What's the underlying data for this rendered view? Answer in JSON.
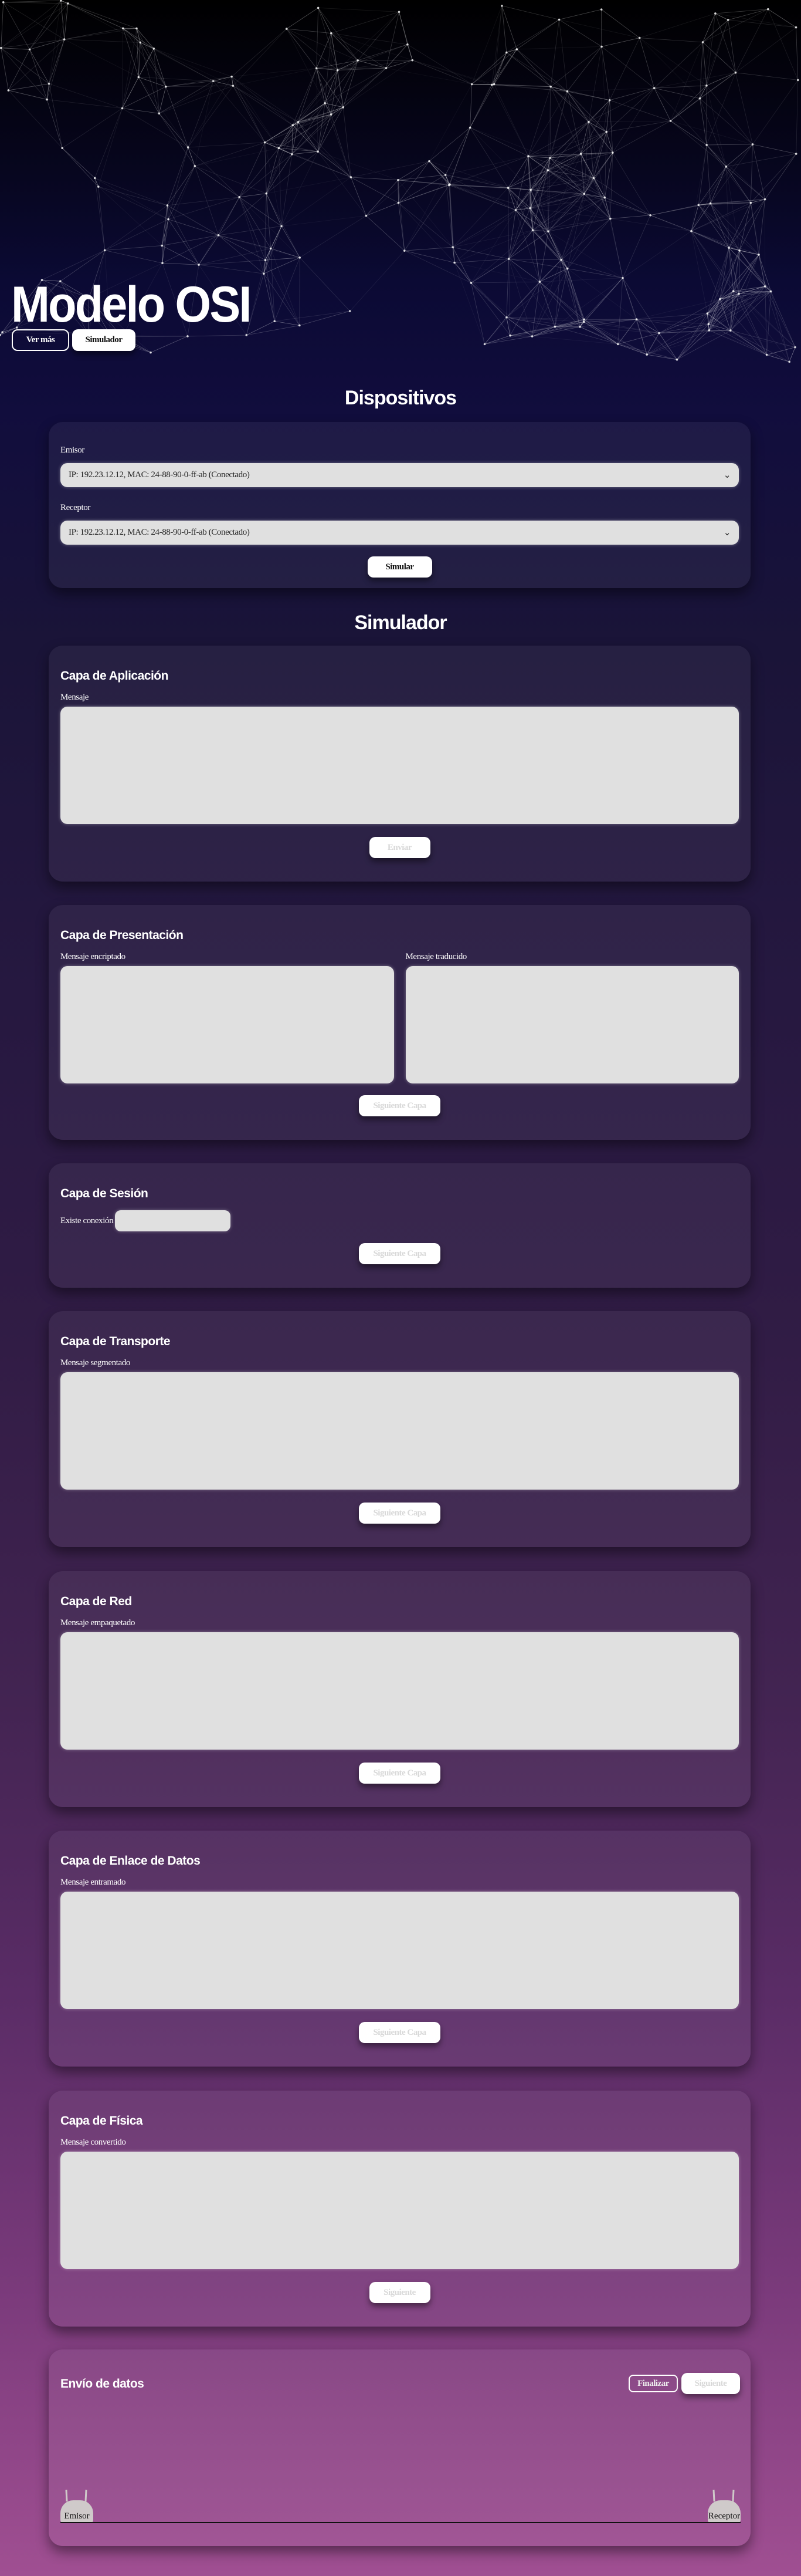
{
  "hero": {
    "title": "Modelo OSI",
    "buttons": {
      "ver_mas": "Ver más",
      "simulador": "Simulador"
    }
  },
  "devices": {
    "heading": "Dispositivos",
    "emisor_label": "Emisor",
    "emisor_value": "IP: 192.23.12.12, MAC: 24-88-90-0-ff-ab (Conectado)",
    "receptor_label": "Receptor",
    "receptor_value": "IP: 192.23.12.12, MAC: 24-88-90-0-ff-ab (Conectado)",
    "simulate_label": "Simular"
  },
  "simulator": {
    "heading": "Simulador",
    "application": {
      "title": "Capa de Aplicación",
      "label": "Mensaje",
      "button": "Enviar"
    },
    "presentation": {
      "title": "Capa de Presentación",
      "label_encrypted": "Mensaje encriptado",
      "label_translated": "Mensaje traducido",
      "button": "Siguiente Capa"
    },
    "session": {
      "title": "Capa de Sesión",
      "label": "Existe conexión",
      "button": "Siguiente Capa"
    },
    "transport": {
      "title": "Capa de Transporte",
      "label": "Mensaje segmentado",
      "button": "Siguiente Capa"
    },
    "network": {
      "title": "Capa de Red",
      "label": "Mensaje empaquetado",
      "button": "Siguiente Capa"
    },
    "datalink": {
      "title": "Capa de Enlace de Datos",
      "label": "Mensaje entramado",
      "button": "Siguiente Capa"
    },
    "physical": {
      "title": "Capa de Física",
      "label": "Mensaje convertido",
      "button": "Siguiente"
    },
    "transfer": {
      "title": "Envío de datos",
      "finish": "Finalizar",
      "next": "Siguiente",
      "sender": "Emisor",
      "receiver": "Receptor"
    }
  },
  "colors": {
    "button_bg": "#ffffff",
    "field_bg": "#e0e0e0",
    "page_top": "#000000",
    "page_bottom": "#a04f92"
  }
}
